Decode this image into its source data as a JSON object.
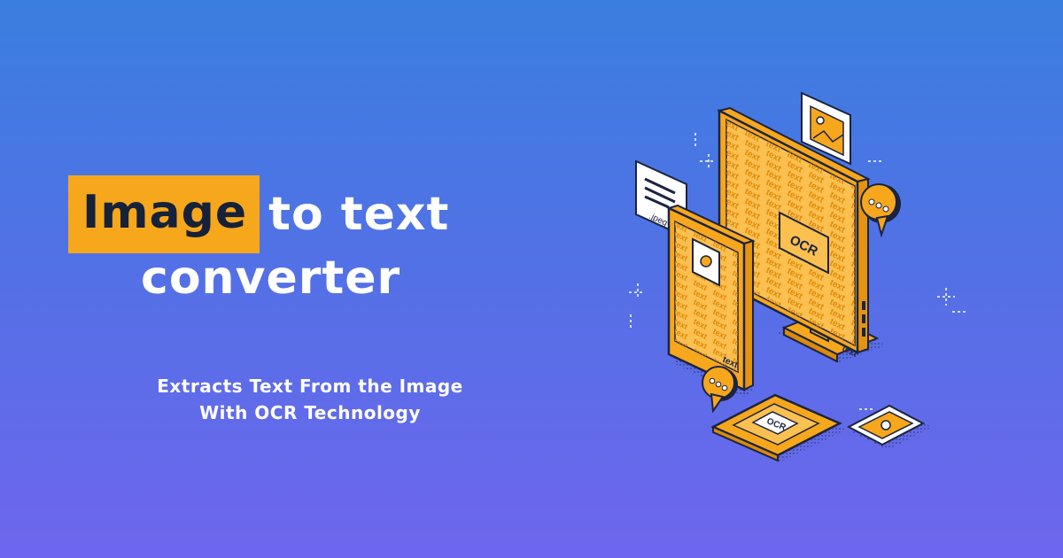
{
  "headline": {
    "highlight_word": "Image",
    "line1_rest": "to text",
    "line2": "converter"
  },
  "subtitle": {
    "line1": "Extracts Text From the Image",
    "line2": "With OCR Technology"
  },
  "illustration": {
    "screen_badge": "OCR",
    "phone_badge": "OCR",
    "file_label": ".jpeg",
    "repeat_word": "text",
    "monitor_tag": "text",
    "tablet_tag": "text"
  },
  "colors": {
    "background_top": "#3a7fe0",
    "background_bottom": "#6e66ee",
    "accent": "#f7a71c",
    "ink": "#16213a"
  }
}
